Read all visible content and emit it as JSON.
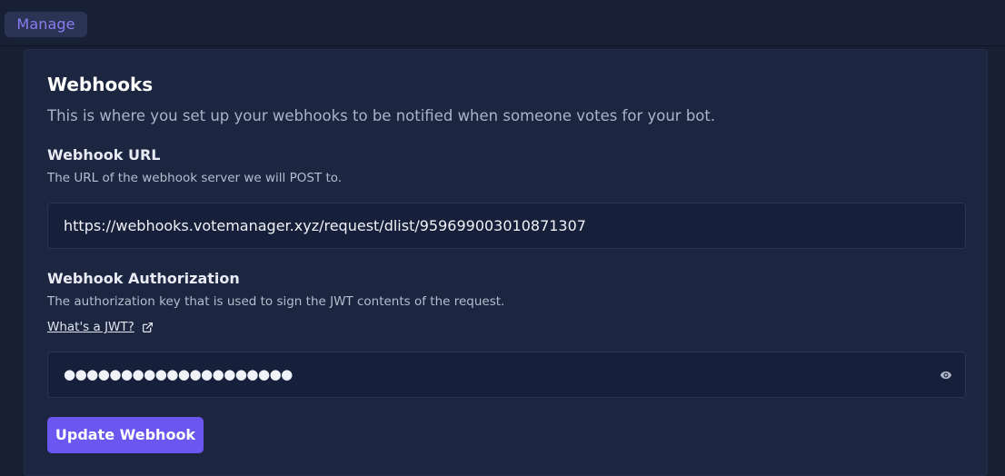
{
  "header": {
    "tab_label": "Manage"
  },
  "webhooks": {
    "title": "Webhooks",
    "description": "This is where you set up your webhooks to be notified when someone votes for your bot.",
    "url_field": {
      "label": "Webhook URL",
      "help": "The URL of the webhook server we will POST to.",
      "value": "https://webhooks.votemanager.xyz/request/dlist/959699003010871307"
    },
    "auth_field": {
      "label": "Webhook Authorization",
      "help": "The authorization key that is used to sign the JWT contents of the request.",
      "link_text": "What's a JWT?",
      "value_masked": "●●●●●●●●●●●●●●●●●●●●"
    },
    "submit_label": "Update Webhook"
  },
  "icons": {
    "external_link": "external-link-icon",
    "reveal": "eye-icon"
  },
  "colors": {
    "accent": "#6c56f0",
    "tab_text": "#8b7cf0",
    "background": "#171f33",
    "card": "#1c2640"
  }
}
